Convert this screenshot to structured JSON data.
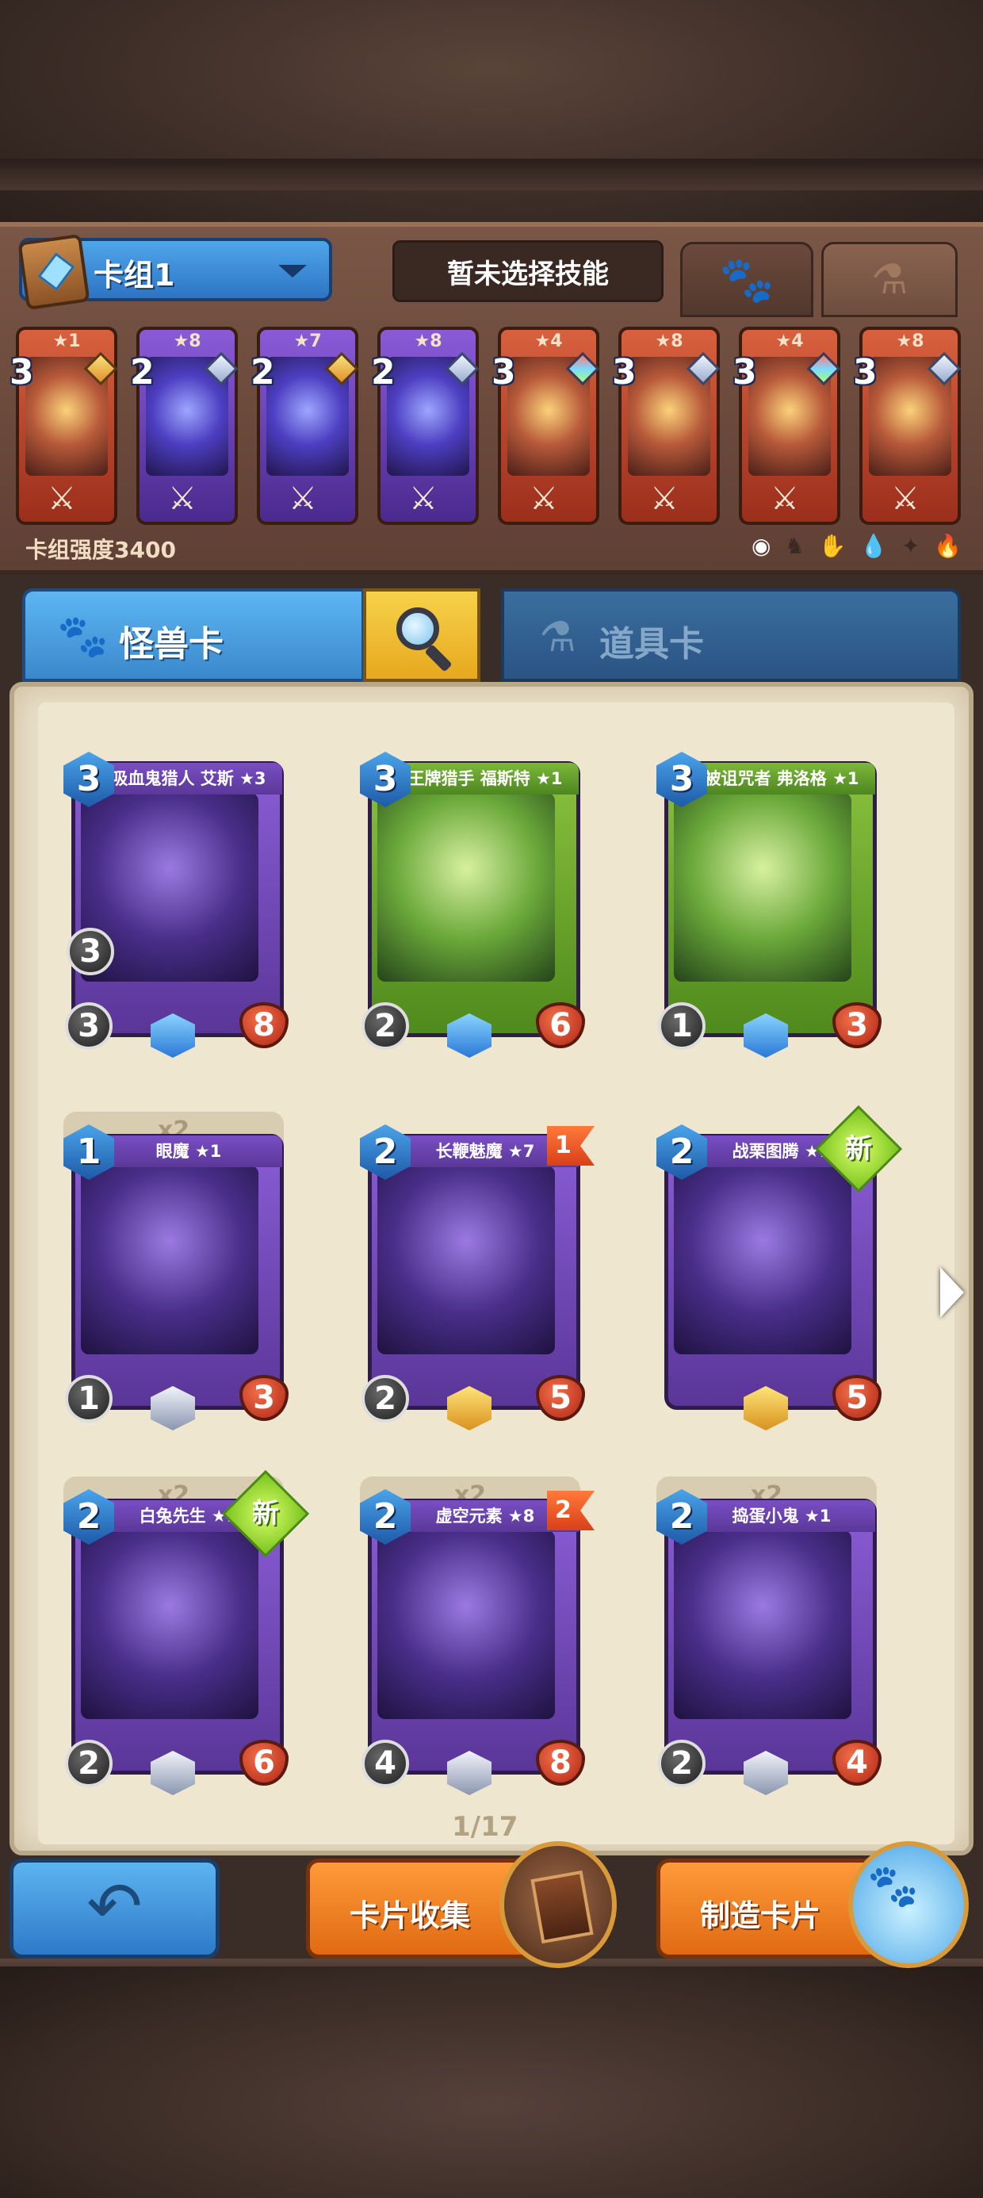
{
  "deck": {
    "name": "卡组1",
    "skill_label": "暂未选择技能",
    "power_label": "卡组强度3400",
    "tabs": {
      "monster_icon": "paw-icon",
      "item_icon": "potion-icon"
    },
    "cards": [
      {
        "stars": "★1",
        "cost": "3",
        "gem": "gold",
        "color": "red"
      },
      {
        "stars": "★8",
        "cost": "2",
        "gem": "silver",
        "color": "purple"
      },
      {
        "stars": "★7",
        "cost": "2",
        "gem": "gold",
        "color": "purple"
      },
      {
        "stars": "★8",
        "cost": "2",
        "gem": "silver",
        "color": "purple"
      },
      {
        "stars": "★4",
        "cost": "3",
        "gem": "rainbow",
        "color": "red"
      },
      {
        "stars": "★8",
        "cost": "3",
        "gem": "silver",
        "color": "red"
      },
      {
        "stars": "★4",
        "cost": "3",
        "gem": "rainbow",
        "color": "red"
      },
      {
        "stars": "★8",
        "cost": "3",
        "gem": "silver",
        "color": "red"
      }
    ]
  },
  "categories": {
    "monster_label": "怪兽卡",
    "items_label": "道具卡"
  },
  "collection": {
    "page": "1/17",
    "cards": [
      {
        "title": "吸血鬼猎人 艾斯 ★3",
        "cost": "3",
        "attack": "3",
        "extra": "3",
        "hp": "8",
        "color": "purple",
        "dup": "",
        "badge": "",
        "rarity": "star"
      },
      {
        "title": "王牌猎手 福斯特 ★1",
        "cost": "3",
        "attack": "2",
        "extra": "",
        "hp": "6",
        "color": "green",
        "dup": "",
        "badge": "",
        "rarity": "star"
      },
      {
        "title": "被诅咒者 弗洛格 ★1",
        "cost": "3",
        "attack": "1",
        "extra": "",
        "hp": "3",
        "color": "green",
        "dup": "",
        "badge": "",
        "rarity": "star"
      },
      {
        "title": "眼魔 ★1",
        "cost": "1",
        "attack": "1",
        "extra": "",
        "hp": "3",
        "color": "purple",
        "dup": "x2",
        "badge": "",
        "rarity": "silver"
      },
      {
        "title": "长鞭魅魔 ★7",
        "cost": "2",
        "attack": "2",
        "extra": "",
        "hp": "5",
        "color": "purple",
        "dup": "",
        "badge": "1",
        "rarity": "gold"
      },
      {
        "title": "战栗图腾 ★1",
        "cost": "2",
        "attack": "",
        "extra": "",
        "hp": "5",
        "color": "purple",
        "dup": "",
        "badge": "新",
        "rarity": "gold"
      },
      {
        "title": "白兔先生 ★1",
        "cost": "2",
        "attack": "2",
        "extra": "",
        "hp": "6",
        "color": "purple",
        "dup": "x2",
        "badge": "新",
        "rarity": "silver"
      },
      {
        "title": "虚空元素 ★8",
        "cost": "2",
        "attack": "4",
        "extra": "",
        "hp": "8",
        "color": "purple",
        "dup": "x2",
        "badge": "2",
        "rarity": "silver"
      },
      {
        "title": "捣蛋小鬼 ★1",
        "cost": "2",
        "attack": "2",
        "extra": "",
        "hp": "4",
        "color": "purple",
        "dup": "x2",
        "badge": "",
        "rarity": "silver"
      }
    ]
  },
  "buttons": {
    "back_icon": "back-arrow-icon",
    "collect_label": "卡片收集",
    "craft_label": "制造卡片"
  }
}
